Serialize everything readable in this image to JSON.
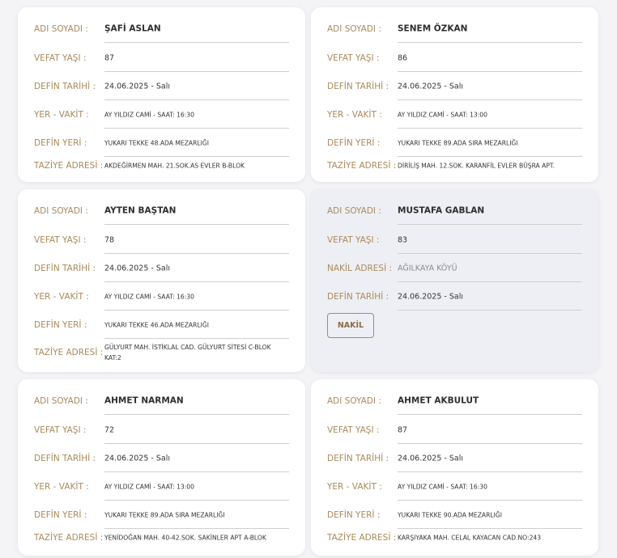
{
  "labels": {
    "name": "ADI SOYADI :",
    "age": "VEFAT YAŞI :",
    "burial_date": "DEFİN TARİHİ :",
    "place_time": "YER - VAKİT :",
    "burial_place": "DEFİN YERİ :",
    "condolence": "TAZİYE ADRESİ :",
    "transfer": "NAKİL ADRESİ :"
  },
  "cards": [
    {
      "name": "ŞAFİ ASLAN",
      "age": "87",
      "burial_date": "24.06.2025 - Salı",
      "place_time": "AY YILDIZ CAMİ - SAAT: 16:30",
      "burial_place": "YUKARI TEKKE 48.ADA MEZARLIĞI",
      "condolence": "AKDEĞİRMEN MAH. 21.SOK.AS EVLER B-BLOK"
    },
    {
      "name": "SENEM ÖZKAN",
      "age": "86",
      "burial_date": "24.06.2025 - Salı",
      "place_time": "AY YILDIZ CAMİ - SAAT: 13:00",
      "burial_place": "YUKARI TEKKE 89.ADA SIRA MEZARLIĞI",
      "condolence": "DİRİLİŞ MAH. 12.SOK. KARANFİL EVLER BÜŞRA APT."
    },
    {
      "name": "AYTEN BAŞTAN",
      "age": "78",
      "burial_date": "24.06.2025 - Salı",
      "place_time": "AY YILDIZ CAMİ - SAAT: 16:30",
      "burial_place": "YUKARI TEKKE 46.ADA MEZARLIĞI",
      "condolence": "GÜLYURT MAH. İSTİKLAL CAD. GÜLYURT SİTESİ C-BLOK KAT:2"
    },
    {
      "name": "MUSTAFA GABLAN",
      "age": "83",
      "transfer": "AĞILKAYA KÖYÜ",
      "burial_date": "24.06.2025 - Salı",
      "button": "NAKİL"
    },
    {
      "name": "AHMET NARMAN",
      "age": "72",
      "burial_date": "24.06.2025 - Salı",
      "place_time": "AY YILDIZ CAMİ - SAAT: 13:00",
      "burial_place": "YUKARI TEKKE 89.ADA SIRA MEZARLIĞI",
      "condolence": "YENİDOĞAN MAH. 40-42.SOK. SAKİNLER APT A-BLOK"
    },
    {
      "name": "AHMET AKBULUT",
      "age": "87",
      "burial_date": "24.06.2025 - Salı",
      "place_time": "AY YILDIZ CAMİ - SAAT: 16:30",
      "burial_place": "YUKARI TEKKE 90.ADA MEZARLIĞI",
      "condolence": "KARŞIYAKA MAH. CELAL KAYACAN CAD.NO:243"
    }
  ]
}
